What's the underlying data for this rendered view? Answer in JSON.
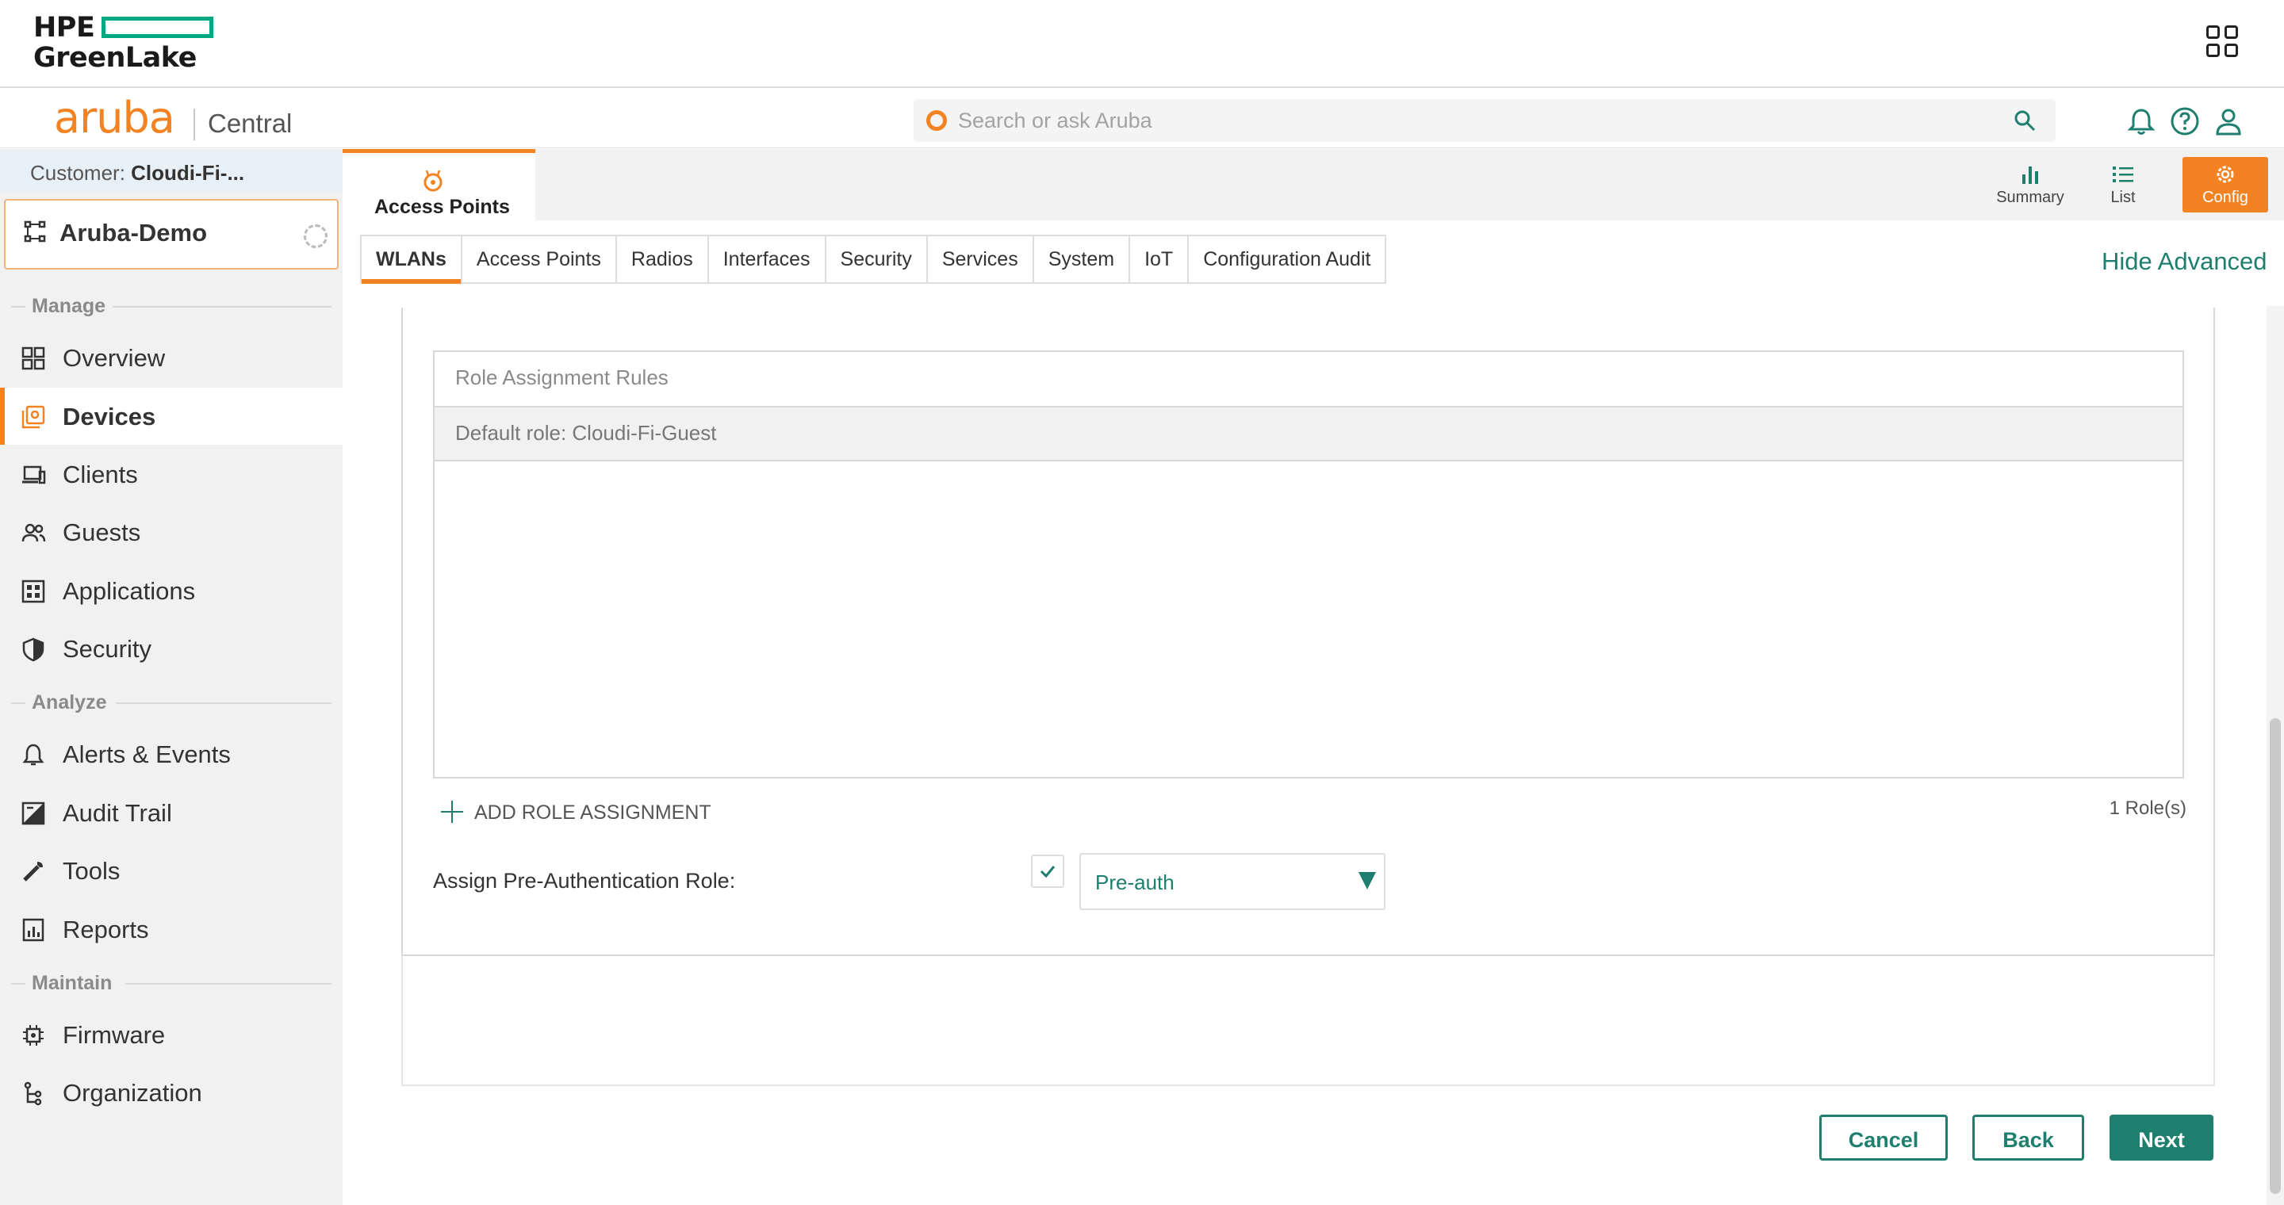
{
  "greenlake": {
    "logo_line1": "HPE",
    "logo_line2": "GreenLake",
    "apps_icon": "app-grid-icon"
  },
  "header": {
    "brand": "aruba",
    "product": "Central",
    "search_placeholder": "Search or ask Aruba",
    "icons": [
      "bell-icon",
      "help-icon",
      "user-icon"
    ]
  },
  "sidebar": {
    "customer_label": "Customer:",
    "customer_name": "Cloudi-Fi-...",
    "group_name": "Aruba-Demo",
    "sections": {
      "manage": "Manage",
      "analyze": "Analyze",
      "maintain": "Maintain"
    },
    "items": [
      {
        "label": "Overview",
        "icon": "grid-icon"
      },
      {
        "label": "Devices",
        "icon": "devices-icon",
        "active": true
      },
      {
        "label": "Clients",
        "icon": "laptop-icon"
      },
      {
        "label": "Guests",
        "icon": "people-icon"
      },
      {
        "label": "Applications",
        "icon": "apps-icon"
      },
      {
        "label": "Security",
        "icon": "shield-icon"
      },
      {
        "label": "Alerts & Events",
        "icon": "bell-icon"
      },
      {
        "label": "Audit Trail",
        "icon": "audit-icon"
      },
      {
        "label": "Tools",
        "icon": "wrench-icon"
      },
      {
        "label": "Reports",
        "icon": "report-icon"
      },
      {
        "label": "Firmware",
        "icon": "chip-icon"
      },
      {
        "label": "Organization",
        "icon": "org-icon"
      }
    ]
  },
  "topstrip": {
    "device_tab": "Access Points",
    "views": [
      {
        "label": "Summary",
        "icon": "bar-chart-icon"
      },
      {
        "label": "List",
        "icon": "list-icon"
      },
      {
        "label": "Config",
        "icon": "gear-icon",
        "active": true
      }
    ]
  },
  "subtabs": [
    "WLANs",
    "Access Points",
    "Radios",
    "Interfaces",
    "Security",
    "Services",
    "System",
    "IoT",
    "Configuration Audit"
  ],
  "hide_advanced": "Hide Advanced",
  "roles": {
    "header": "Role Assignment Rules",
    "default_row": "Default role: Cloudi-Fi-Guest",
    "add_label": "ADD ROLE ASSIGNMENT",
    "count": "1 Role(s)",
    "pre_auth_label": "Assign Pre-Authentication Role:",
    "pre_auth_checked": true,
    "pre_auth_value": "Pre-auth"
  },
  "buttons": {
    "cancel": "Cancel",
    "back": "Back",
    "next": "Next"
  },
  "colors": {
    "accent_orange": "#f28222",
    "accent_teal": "#1f7f6e",
    "hpe_green": "#01a982"
  }
}
